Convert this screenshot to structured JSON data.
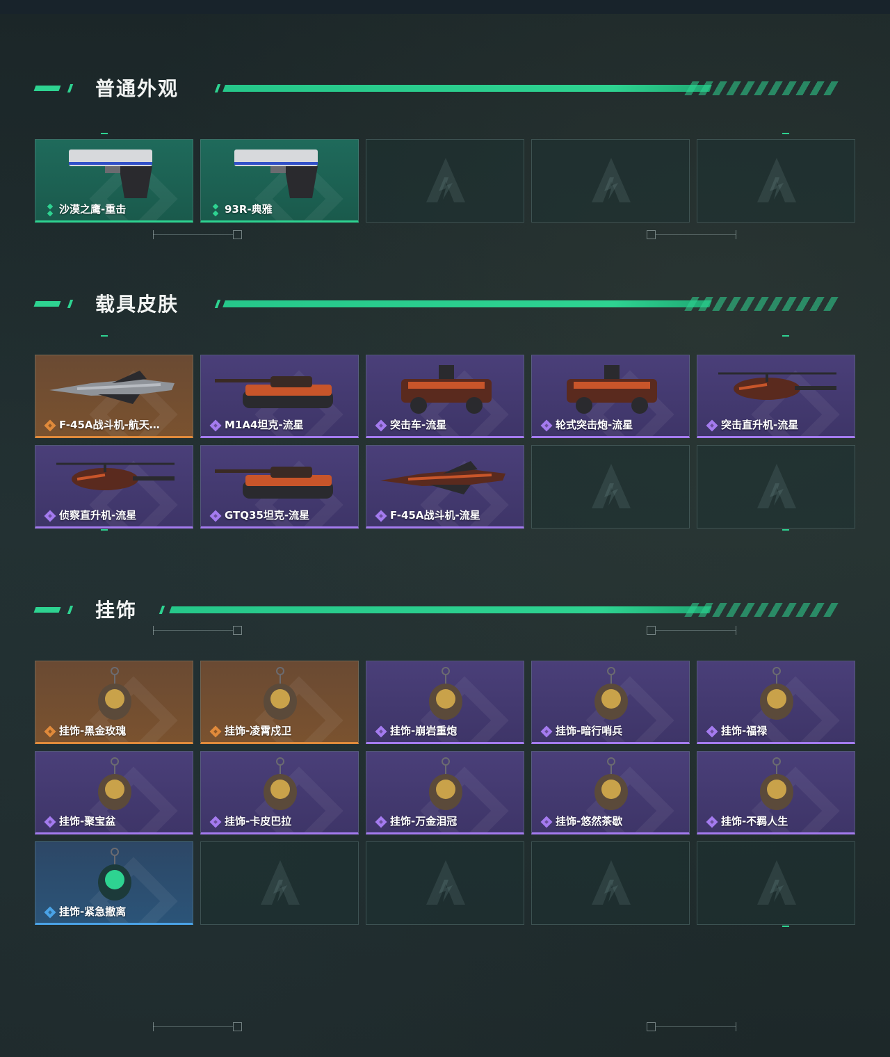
{
  "colors": {
    "accent": "#2ed391",
    "green_rarity": "#2ed391",
    "purple_rarity": "#a47bef",
    "orange_rarity": "#e08a3b",
    "blue_rarity": "#4aa2e6"
  },
  "sections": [
    {
      "title": "普通外观",
      "cards": [
        {
          "label": "沙漠之鹰-重击",
          "rarity": "green",
          "icon": "pistol-icon"
        },
        {
          "label": "93R-典雅",
          "rarity": "green",
          "icon": "pistol-icon"
        },
        {
          "label": "",
          "rarity": "empty",
          "icon": "placeholder-logo-icon"
        },
        {
          "label": "",
          "rarity": "empty",
          "icon": "placeholder-logo-icon"
        },
        {
          "label": "",
          "rarity": "empty",
          "icon": "placeholder-logo-icon"
        }
      ]
    },
    {
      "title": "载具皮肤",
      "cards": [
        {
          "label": "F-45A战斗机-航天…",
          "rarity": "orange",
          "icon": "jet-icon"
        },
        {
          "label": "M1A4坦克-流星",
          "rarity": "purple",
          "icon": "tank-icon"
        },
        {
          "label": "突击车-流星",
          "rarity": "purple",
          "icon": "armored-car-icon"
        },
        {
          "label": "轮式突击炮-流星",
          "rarity": "purple",
          "icon": "armored-car-icon"
        },
        {
          "label": "突击直升机-流星",
          "rarity": "purple",
          "icon": "helicopter-icon"
        },
        {
          "label": "侦察直升机-流星",
          "rarity": "purple",
          "icon": "helicopter-icon"
        },
        {
          "label": "GTQ35坦克-流星",
          "rarity": "purple",
          "icon": "tank-icon"
        },
        {
          "label": "F-45A战斗机-流星",
          "rarity": "purple",
          "icon": "jet-icon"
        },
        {
          "label": "",
          "rarity": "empty",
          "icon": "placeholder-logo-icon"
        },
        {
          "label": "",
          "rarity": "empty",
          "icon": "placeholder-logo-icon"
        }
      ]
    },
    {
      "title": "挂饰",
      "cards": [
        {
          "label": "挂饰-黑金玫瑰",
          "rarity": "orange",
          "icon": "charm-icon"
        },
        {
          "label": "挂饰-凌霄戍卫",
          "rarity": "orange",
          "icon": "charm-icon"
        },
        {
          "label": "挂饰-崩岩重炮",
          "rarity": "purple",
          "icon": "charm-icon"
        },
        {
          "label": "挂饰-暗行哨兵",
          "rarity": "purple",
          "icon": "charm-icon"
        },
        {
          "label": "挂饰-福禄",
          "rarity": "purple",
          "icon": "charm-icon"
        },
        {
          "label": "挂饰-聚宝盆",
          "rarity": "purple",
          "icon": "charm-icon"
        },
        {
          "label": "挂饰-卡皮巴拉",
          "rarity": "purple",
          "icon": "charm-icon"
        },
        {
          "label": "挂饰-万金泪冠",
          "rarity": "purple",
          "icon": "charm-icon"
        },
        {
          "label": "挂饰-悠然茶歇",
          "rarity": "purple",
          "icon": "charm-icon"
        },
        {
          "label": "挂饰-不羁人生",
          "rarity": "purple",
          "icon": "charm-icon"
        },
        {
          "label": "挂饰-紧急撤离",
          "rarity": "blue",
          "icon": "charm-icon"
        },
        {
          "label": "",
          "rarity": "empty",
          "icon": "placeholder-logo-icon"
        },
        {
          "label": "",
          "rarity": "empty",
          "icon": "placeholder-logo-icon"
        },
        {
          "label": "",
          "rarity": "empty",
          "icon": "placeholder-logo-icon"
        },
        {
          "label": "",
          "rarity": "empty",
          "icon": "placeholder-logo-icon"
        }
      ]
    }
  ]
}
